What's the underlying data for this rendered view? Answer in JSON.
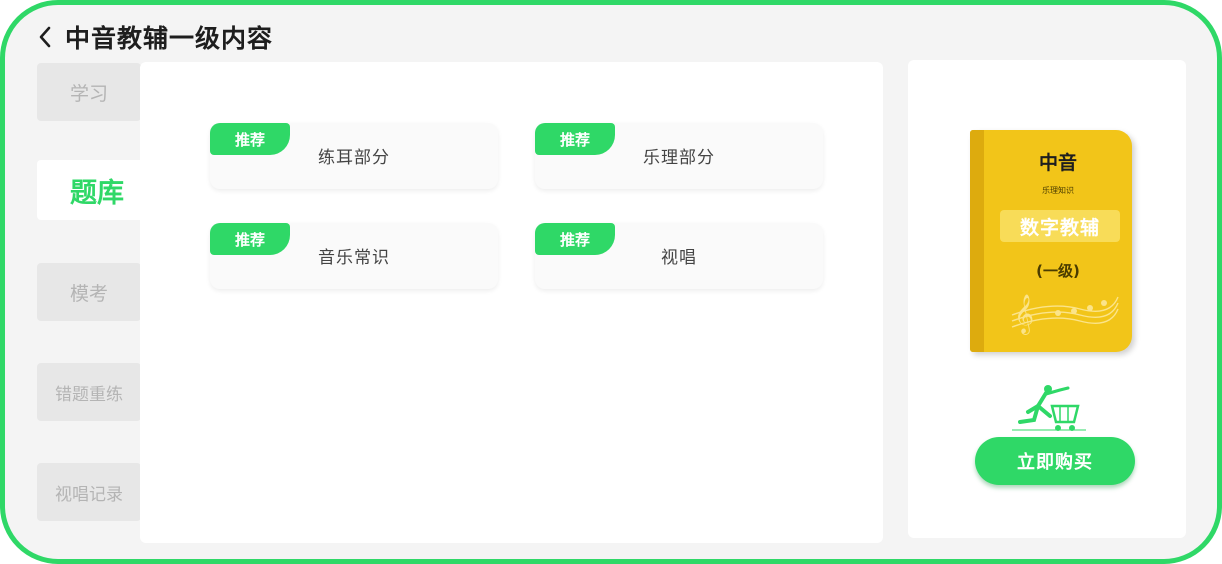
{
  "header": {
    "title": "中音教辅一级内容"
  },
  "sidebar": {
    "items": [
      {
        "label": "学习"
      },
      {
        "label": "题库"
      },
      {
        "label": "模考"
      },
      {
        "label": "错题重练"
      },
      {
        "label": "视唱记录"
      }
    ],
    "active_index": 1
  },
  "main": {
    "cards": [
      {
        "badge": "推荐",
        "label": "练耳部分"
      },
      {
        "badge": "推荐",
        "label": "乐理部分"
      },
      {
        "badge": "推荐",
        "label": "音乐常识"
      },
      {
        "badge": "推荐",
        "label": "视唱"
      }
    ]
  },
  "promo": {
    "book": {
      "title": "中音",
      "subtitle": "乐理知识",
      "band": "数字教辅",
      "level": "(一级)"
    },
    "buy_label": "立即购买"
  },
  "colors": {
    "accent": "#2fd867",
    "book": "#f2c519",
    "background": "#f4f4f4"
  }
}
